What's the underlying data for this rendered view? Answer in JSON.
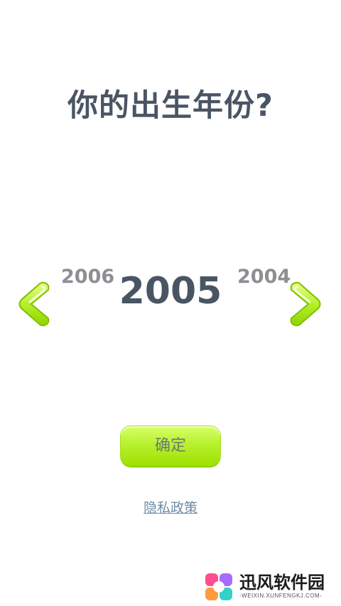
{
  "screen": {
    "title": "你的出生年份?",
    "year_prev": "2006",
    "year_current": "2005",
    "year_next": "2004",
    "confirm_label": "确定",
    "privacy_label": "隐私政策"
  },
  "icons": {
    "left": "chevron-left-icon",
    "right": "chevron-right-icon"
  },
  "watermark": {
    "name": "迅风软件园",
    "url": "-WEIXIN.XUNFENGKJ.COM-"
  },
  "colors": {
    "title": "#4a5564",
    "side_year": "#8d8f92",
    "accent_green": "#b7f12e",
    "link": "#6f89a7"
  }
}
